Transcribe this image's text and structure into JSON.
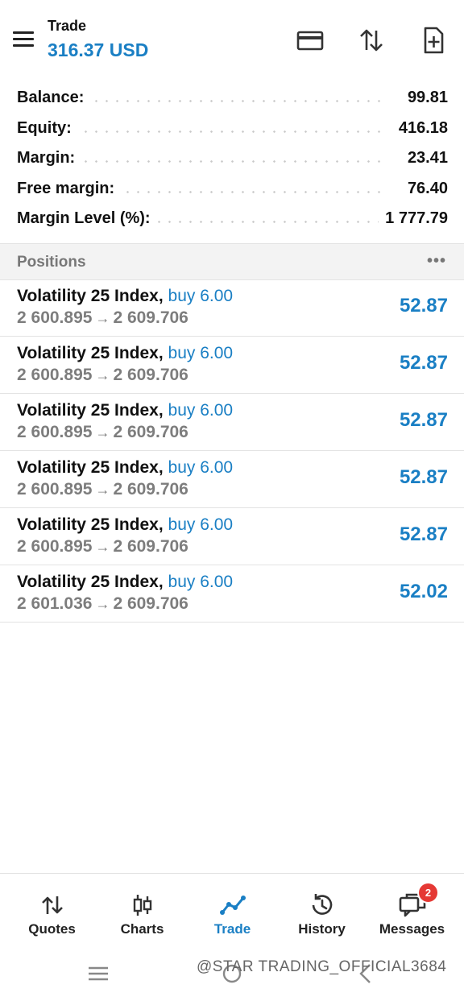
{
  "header": {
    "title": "Trade",
    "subtitle": "316.37 USD"
  },
  "summary": [
    {
      "label": "Balance:",
      "value": "99.81"
    },
    {
      "label": "Equity:",
      "value": "416.18"
    },
    {
      "label": "Margin:",
      "value": "23.41"
    },
    {
      "label": "Free margin:",
      "value": "76.40"
    },
    {
      "label": "Margin Level (%):",
      "value": "1 777.79"
    }
  ],
  "positions": {
    "title": "Positions",
    "more_icon": "•••",
    "arrow": "→",
    "items": [
      {
        "symbol": "Volatility 25 Index,",
        "side": "buy 6.00",
        "open": "2 600.895",
        "current": "2 609.706",
        "profit": "52.87"
      },
      {
        "symbol": "Volatility 25 Index,",
        "side": "buy 6.00",
        "open": "2 600.895",
        "current": "2 609.706",
        "profit": "52.87"
      },
      {
        "symbol": "Volatility 25 Index,",
        "side": "buy 6.00",
        "open": "2 600.895",
        "current": "2 609.706",
        "profit": "52.87"
      },
      {
        "symbol": "Volatility 25 Index,",
        "side": "buy 6.00",
        "open": "2 600.895",
        "current": "2 609.706",
        "profit": "52.87"
      },
      {
        "symbol": "Volatility 25 Index,",
        "side": "buy 6.00",
        "open": "2 600.895",
        "current": "2 609.706",
        "profit": "52.87"
      },
      {
        "symbol": "Volatility 25 Index,",
        "side": "buy 6.00",
        "open": "2 601.036",
        "current": "2 609.706",
        "profit": "52.02"
      }
    ]
  },
  "nav": {
    "items": [
      {
        "label": "Quotes",
        "icon": "quotes-icon"
      },
      {
        "label": "Charts",
        "icon": "charts-icon"
      },
      {
        "label": "Trade",
        "icon": "trade-icon",
        "active": true
      },
      {
        "label": "History",
        "icon": "history-icon"
      },
      {
        "label": "Messages",
        "icon": "messages-icon",
        "badge": "2"
      }
    ]
  },
  "watermark": "@STAR TRADING_OFFICIAL3684",
  "colors": {
    "accent": "#1a7fc4",
    "badge": "#e53935",
    "muted": "#7d7d7d"
  }
}
